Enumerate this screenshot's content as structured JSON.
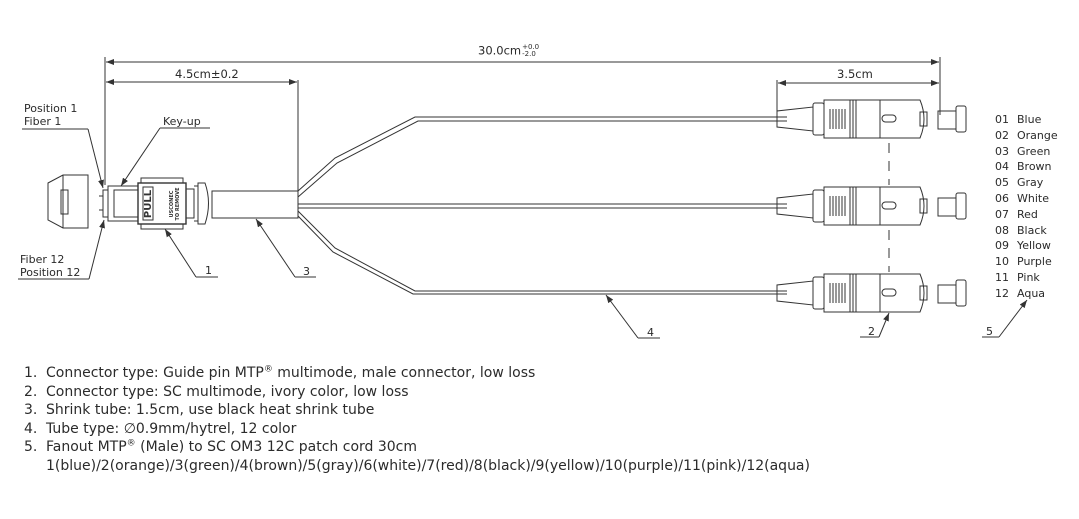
{
  "dimensions": {
    "overall": {
      "value": "30.0cm",
      "tol_plus": "+0.0",
      "tol_minus": "-2.0"
    },
    "mtp_length": "4.5cm±0.2",
    "sc_length": "3.5cm"
  },
  "callouts": {
    "position_1": "Position  1",
    "fiber_1": "Fiber  1",
    "key_up": "Key-up",
    "fiber_12": "Fiber  12",
    "position_12": "Position  12",
    "balloon_1": "1",
    "balloon_2": "2",
    "balloon_3": "3",
    "balloon_4": "4",
    "balloon_5": "5"
  },
  "connector_marks": {
    "pull": "PULL",
    "uscomec": "USCONEC",
    "to_remove": "TO REMOVE"
  },
  "fiber_colors": [
    {
      "num": "01",
      "color": "Blue"
    },
    {
      "num": "02",
      "color": "Orange"
    },
    {
      "num": "03",
      "color": "Green"
    },
    {
      "num": "04",
      "color": "Brown"
    },
    {
      "num": "05",
      "color": "Gray"
    },
    {
      "num": "06",
      "color": "White"
    },
    {
      "num": "07",
      "color": "Red"
    },
    {
      "num": "08",
      "color": "Black"
    },
    {
      "num": "09",
      "color": "Yellow"
    },
    {
      "num": "10",
      "color": "Purple"
    },
    {
      "num": "11",
      "color": "Pink"
    },
    {
      "num": "12",
      "color": "Aqua"
    }
  ],
  "notes": [
    {
      "idx": "1.",
      "pre": "Connector type: Guide pin MTP",
      "sup": "®",
      "post": " multimode, male connector, low loss"
    },
    {
      "idx": "2.",
      "pre": "Connector type: SC multimode, ivory color, low loss",
      "sup": "",
      "post": ""
    },
    {
      "idx": "3.",
      "pre": "Shrink tube: 1.5cm, use black heat shrink tube",
      "sup": "",
      "post": ""
    },
    {
      "idx": "4.",
      "pre": "Tube type: ∅0.9mm/hytrel, 12 color",
      "sup": "",
      "post": ""
    },
    {
      "idx": "5.",
      "pre": "Fanout MTP",
      "sup": "®",
      "post": " (Male) to SC OM3 12C patch cord 30cm"
    }
  ],
  "note_5_continuation": "1(blue)/2(orange)/3(green)/4(brown)/5(gray)/6(white)/7(red)/8(black)/9(yellow)/10(purple)/11(pink)/12(aqua)"
}
